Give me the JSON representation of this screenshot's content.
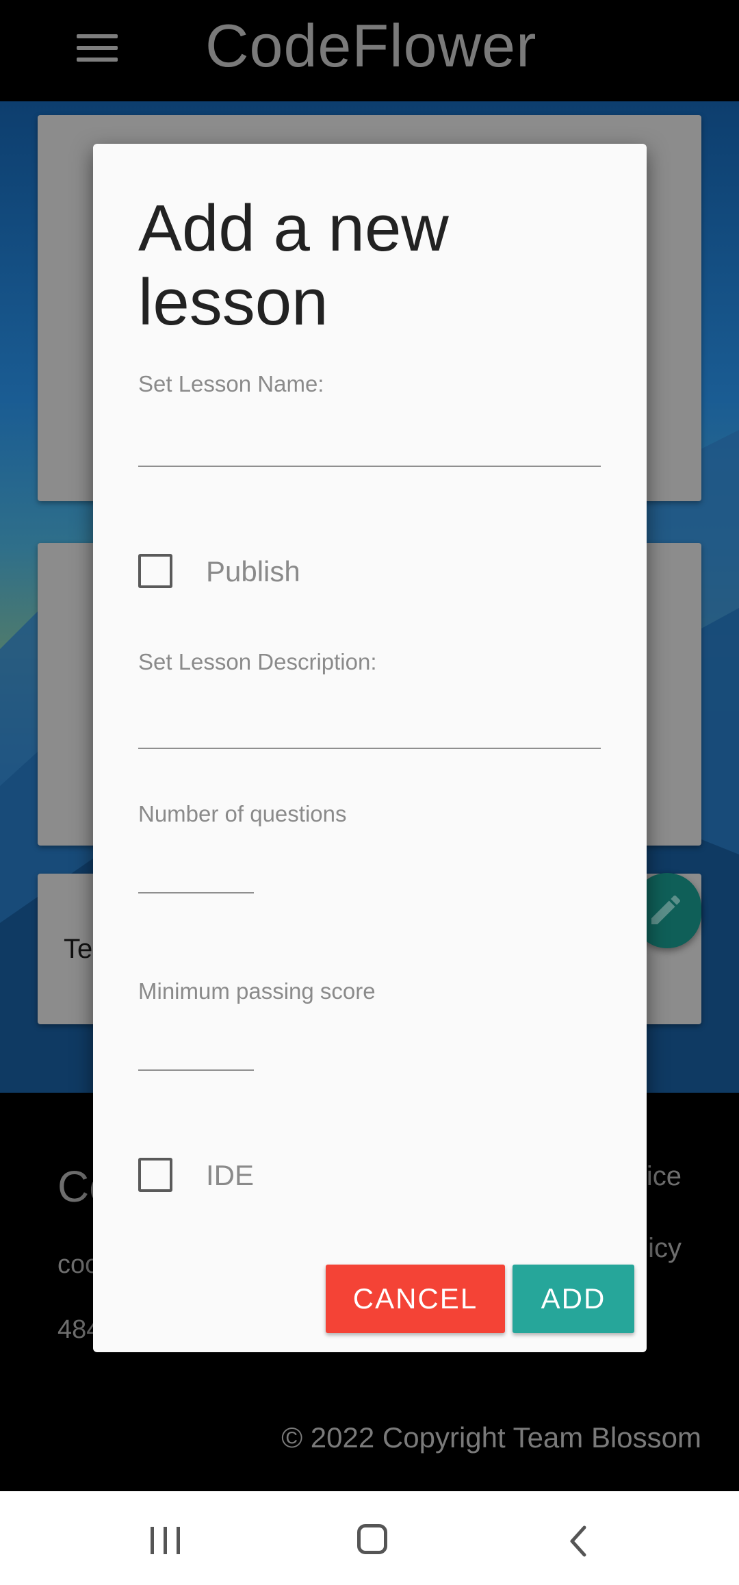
{
  "app_bar": {
    "title": "CodeFlower",
    "menu_icon": "hamburger-menu-icon"
  },
  "background_cards": {
    "card3_text": "Te"
  },
  "footer": {
    "brand_partial": "Co",
    "email_partial": "coo",
    "phone_partial": "484",
    "link1_partial": "ice",
    "link2_partial": "icy",
    "copyright": "© 2022 Copyright Team Blossom"
  },
  "dialog": {
    "title": "Add a new lesson",
    "lesson_name": {
      "label": "Set Lesson Name:",
      "value": ""
    },
    "publish": {
      "label": "Publish",
      "checked": false
    },
    "lesson_description": {
      "label": "Set Lesson Description:",
      "value": ""
    },
    "num_questions": {
      "label": "Number of questions",
      "value": ""
    },
    "min_passing_score": {
      "label": "Minimum passing score",
      "value": ""
    },
    "ide": {
      "label": "IDE",
      "checked": false
    },
    "cancel_label": "CANCEL",
    "add_label": "ADD",
    "colors": {
      "cancel": "#f44336",
      "add": "#26a69a"
    }
  },
  "system_nav": {
    "recents_icon": "recents-icon",
    "home_icon": "home-icon",
    "back_icon": "back-icon"
  }
}
